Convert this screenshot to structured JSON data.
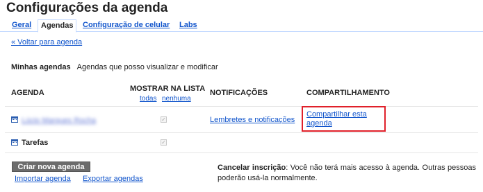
{
  "page": {
    "title": "Configurações da agenda"
  },
  "tabs": [
    {
      "label": "Geral",
      "active": false
    },
    {
      "label": "Agendas",
      "active": true
    },
    {
      "label": "Configuração de celular",
      "active": false
    },
    {
      "label": "Labs",
      "active": false
    }
  ],
  "back_link": "« Voltar para agenda",
  "section": {
    "title": "Minhas agendas",
    "subtitle": "Agendas que posso visualizar e modificar"
  },
  "table": {
    "headers": {
      "calendar": "AGENDA",
      "show_in_list": "MOSTRAR NA LISTA",
      "notifications": "NOTIFICAÇÕES",
      "sharing": "COMPARTILHAMENTO"
    },
    "select_all": "todas",
    "select_none": "nenhuma",
    "rows": [
      {
        "name": "Lúcio Marques Rocha",
        "name_obscured": true,
        "shown": true,
        "notifications_link": "Lembretes e notificações",
        "share_link": "Compartilhar esta agenda"
      },
      {
        "name": "Tarefas",
        "name_obscured": false,
        "shown": true
      }
    ]
  },
  "actions": {
    "create_button": "Criar nova agenda",
    "import_link": "Importar agenda",
    "export_link": "Exportar agendas"
  },
  "cancel_note": {
    "label": "Cancelar inscrição",
    "text": ": Você não terá mais acesso à agenda. Outras pessoas poderão usá-la normalmente."
  },
  "colors": {
    "link": "#1155cc",
    "highlight_box": "#e0202a",
    "tab_border": "#c3d9ff",
    "button_bg": "#6c6c6c"
  }
}
